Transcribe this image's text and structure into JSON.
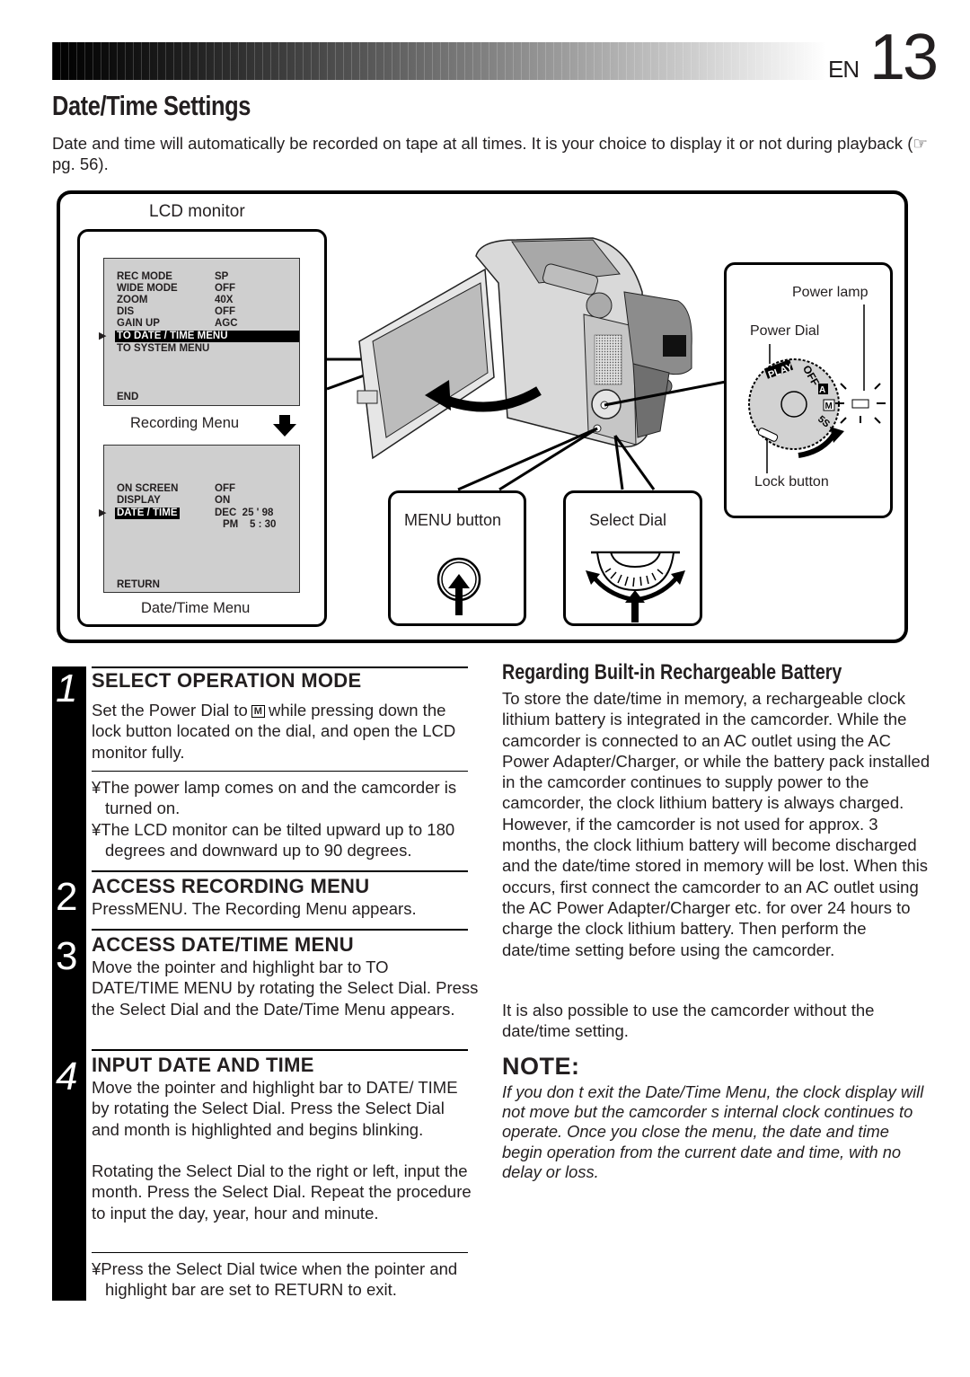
{
  "header": {
    "language": "EN",
    "page_number": "13",
    "title": "Date/Time Settings",
    "intro_text": "Date and time will automatically be recorded on tape at all times. It is your choice to display it or not during playback (☞ pg. 56)."
  },
  "figure": {
    "lcd_monitor_label": "LCD monitor",
    "recording_menu": {
      "caption": "Recording Menu",
      "items": [
        {
          "key": "REC MODE",
          "value": "SP"
        },
        {
          "key": "WIDE MODE",
          "value": "OFF"
        },
        {
          "key": "ZOOM",
          "value": "40X"
        },
        {
          "key": "DIS",
          "value": "OFF"
        },
        {
          "key": "GAIN UP",
          "value": "AGC"
        },
        {
          "key": "TO DATE / TIME MENU",
          "value": ""
        },
        {
          "key": "TO SYSTEM MENU",
          "value": ""
        }
      ],
      "selected_item": "TO DATE / TIME MENU",
      "end_label": "END"
    },
    "datetime_menu": {
      "caption": "Date/Time Menu",
      "items": [
        {
          "key": "ON SCREEN",
          "value": "OFF"
        },
        {
          "key": "DISPLAY",
          "value": "ON"
        },
        {
          "key": "DATE / TIME",
          "value": "DEC  25 ' 98"
        },
        {
          "key": "",
          "value": "PM    5 : 30"
        }
      ],
      "selected_item": "DATE / TIME",
      "return_label": "RETURN"
    },
    "menu_button_label": "MENU button",
    "select_dial_label": "Select Dial",
    "power_lamp_label": "Power lamp",
    "power_dial_label": "Power Dial",
    "lock_button_label": "Lock button",
    "power_dial_positions": [
      "PLAY",
      "OFF",
      "A",
      "M",
      "5S"
    ]
  },
  "steps": [
    {
      "number": "1",
      "heading": "SELECT OPERATION MODE",
      "text_before_icon": "Set the Power Dial to",
      "icon": "M",
      "text_after_icon": "while pressing down the lock button located on the dial, and open the LCD monitor fully.",
      "bullets": [
        "¥The power lamp comes on and the camcorder is turned on.",
        "¥The LCD monitor can be tilted upward up to 180 degrees and downward up to 90 degrees."
      ]
    },
    {
      "number": "2",
      "heading": "ACCESS RECORDING MENU",
      "text": "PressMENU. The Recording Menu appears."
    },
    {
      "number": "3",
      "heading": "ACCESS DATE/TIME MENU",
      "text": "Move the pointer and highlight bar to  TO DATE/TIME MENU  by rotating the Select Dial. Press the Select Dial and the Date/Time Menu appears."
    },
    {
      "number": "4",
      "heading": "INPUT DATE AND TIME",
      "text": "Move the pointer and highlight bar to  DATE/ TIME  by rotating the Select Dial. Press the Select Dial and  month  is highlighted and begins blinking.",
      "text2": "Rotating the Select Dial to the right or left, input the month. Press the Select Dial. Repeat the procedure to input the day, year, hour and minute.",
      "bullets": [
        "¥Press the Select Dial twice when the pointer and highlight bar are set to  RETURN  to exit."
      ]
    }
  ],
  "battery": {
    "heading": "Regarding Built-in Rechargeable Battery",
    "text": "To store the date/time in memory, a rechargeable clock lithium battery is integrated in the camcorder. While the camcorder is connected to an AC outlet using the AC Power Adapter/Charger, or while the battery pack installed in the camcorder continues to supply power to the camcorder, the clock lithium battery is always charged. However, if the camcorder is not used for approx. 3 months, the clock lithium battery will become discharged and the date/time stored in memory will be lost. When this occurs, first connect the camcorder to an AC outlet using the AC Power Adapter/Charger etc. for over 24 hours to charge the clock lithium battery. Then perform the date/time setting before using the camcorder.",
    "text2": "It is also possible to use the camcorder without the date/time setting."
  },
  "note": {
    "heading": "NOTE:",
    "text": "If you don t exit the Date/Time Menu, the clock display will not move but the camcorder s internal clock continues to operate. Once you close the menu, the date and time begin operation from the current date and time, with no delay or loss."
  }
}
